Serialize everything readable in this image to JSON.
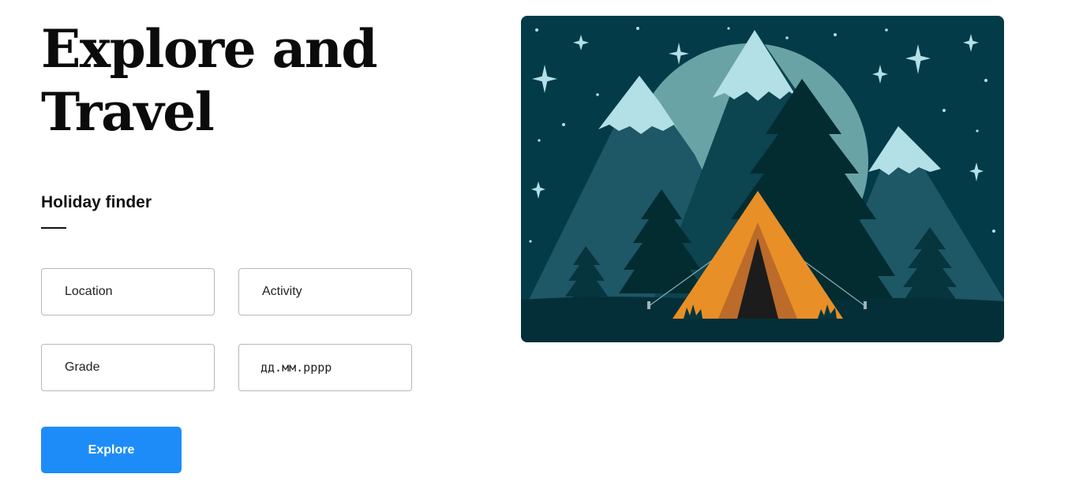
{
  "hero": {
    "title_line1": "Explore and",
    "title_line2": "Travel"
  },
  "finder": {
    "title": "Holiday finder",
    "location_placeholder": "Location",
    "activity_placeholder": "Activity",
    "grade_placeholder": "Grade",
    "date_placeholder": "дд.мм.рррр",
    "submit_label": "Explore"
  },
  "illustration": {
    "subject": "camping-tent-night-mountains",
    "colors": {
      "sky": "#033b48",
      "moon": "#6aa3a6",
      "mountain": "#1e5766",
      "mountain_dark": "#0c4450",
      "snow": "#b3dfe7",
      "tree_dark": "#032c31",
      "tree": "#06353d",
      "ground": "#042f38",
      "tent": "#e88f27",
      "tent_shade": "#bc6b2a",
      "tent_door": "#1c1c1c",
      "stars": "#b3dfe7"
    }
  },
  "colors": {
    "accent": "#1e8cf8",
    "text": "#111111",
    "border": "#b8b8b8"
  }
}
